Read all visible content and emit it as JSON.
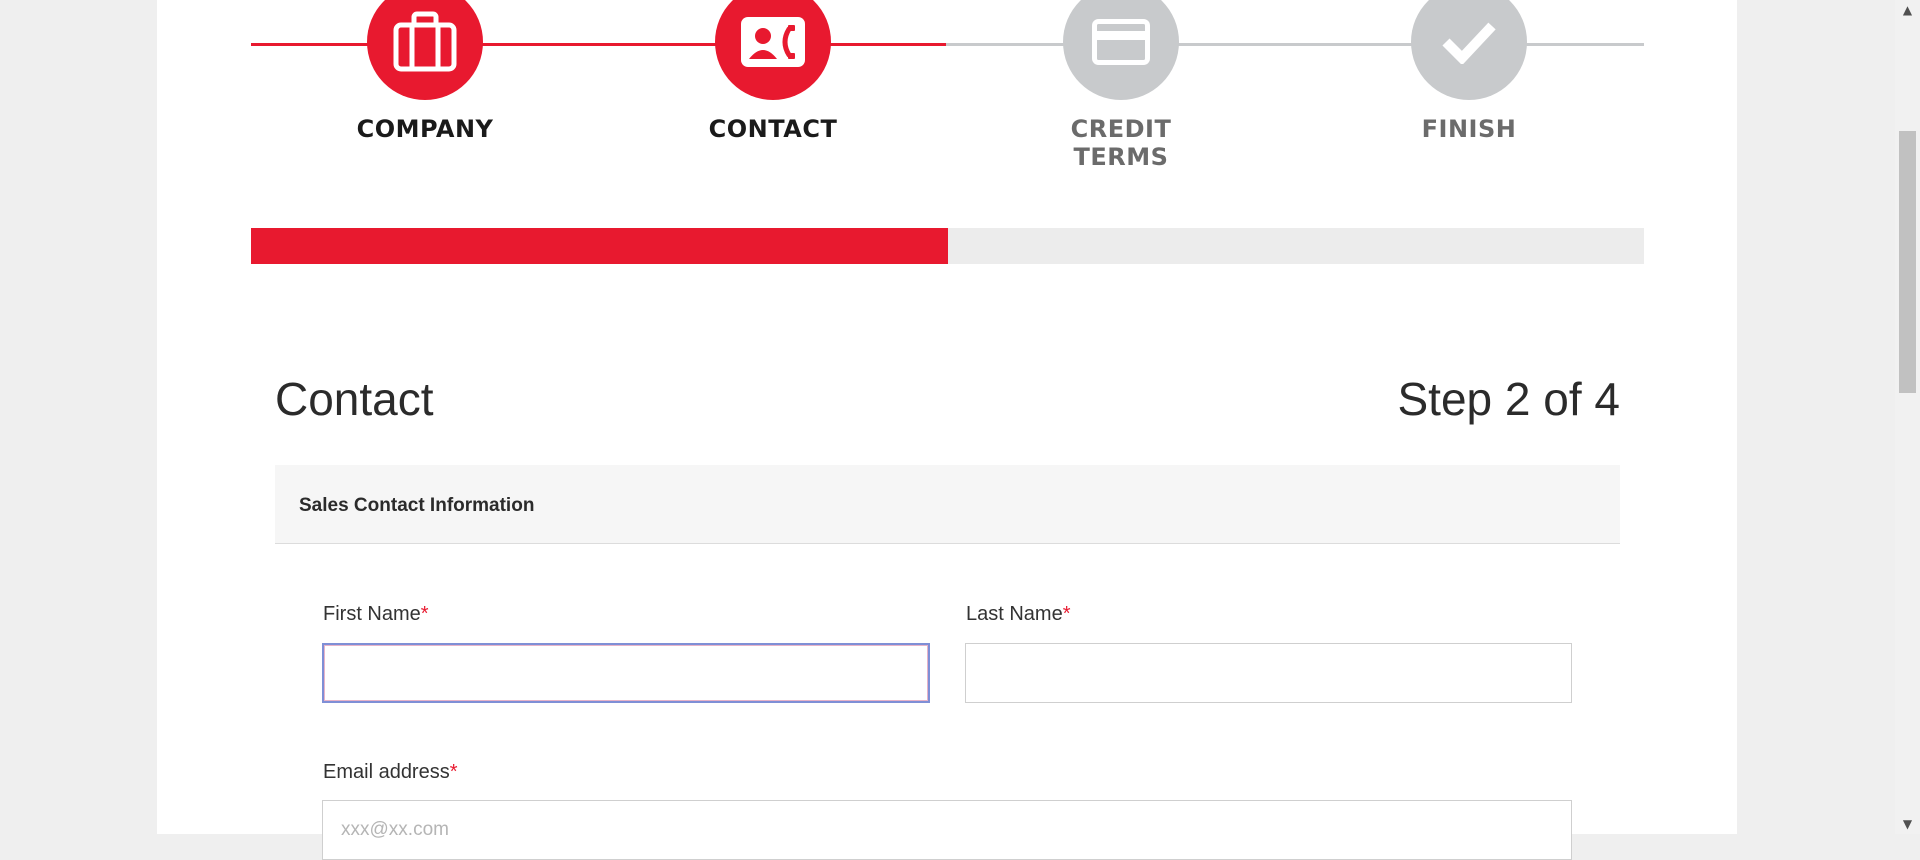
{
  "stepper": {
    "steps": [
      {
        "label": "COMPANY",
        "icon": "briefcase-icon",
        "state": "active"
      },
      {
        "label": "CONTACT",
        "icon": "contact-card-icon",
        "state": "active"
      },
      {
        "label": "CREDIT TERMS",
        "icon": "credit-card-icon",
        "state": "inactive"
      },
      {
        "label": "FINISH",
        "icon": "checkmark-icon",
        "state": "inactive"
      }
    ]
  },
  "progress": {
    "fraction": 0.5
  },
  "heading": {
    "title": "Contact",
    "step_counter": "Step 2 of 4"
  },
  "panel": {
    "title": "Sales Contact Information"
  },
  "form": {
    "first_name": {
      "label": "First Name",
      "required_mark": "*",
      "value": ""
    },
    "last_name": {
      "label": "Last Name",
      "required_mark": "*",
      "value": ""
    },
    "email": {
      "label": "Email address",
      "required_mark": "*",
      "placeholder": "xxx@xx.com"
    }
  },
  "scrollbar": {
    "up_arrow": "▲",
    "down_arrow": "▼"
  },
  "colors": {
    "accent": "#e8192f",
    "inactive": "#c8cacc",
    "background": "#efefef"
  }
}
